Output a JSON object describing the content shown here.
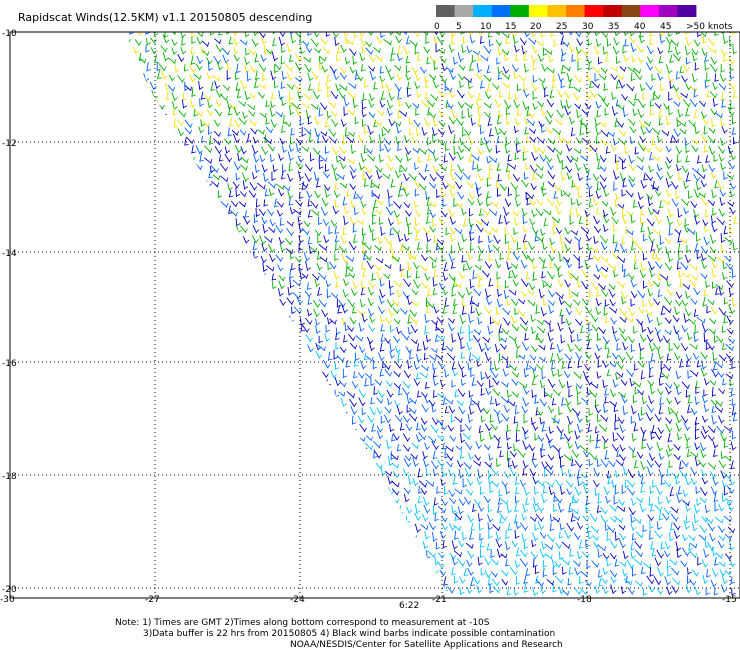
{
  "title": "Rapidscat Winds(12.5KM) v1.1 20150805 descending",
  "colorbar": {
    "labels": [
      "0",
      "5",
      "10",
      "15",
      "20",
      "25",
      "30",
      "35",
      "40",
      "45",
      ">50 knots"
    ],
    "colors": [
      "#606060",
      "#a8a8a8",
      "#00b0ff",
      "#0070ff",
      "#00b000",
      "#ffff00",
      "#ffc000",
      "#ff8000",
      "#ff0000",
      "#c00000",
      "#8b4513",
      "#ff00ff",
      "#a000c0",
      "#5000a0"
    ]
  },
  "map": {
    "lat_labels": [
      "-10",
      "-12",
      "-14",
      "-16",
      "-18",
      "-20"
    ],
    "lon_labels": [
      "-30",
      "-27",
      "-24",
      "-21",
      "-18",
      "-15"
    ],
    "time_label": "6:22",
    "time_color": "#800080",
    "swath_colors": {
      "deep": "#0000c0",
      "mid": "#0060ff",
      "light": "#00c0ff",
      "green": "#00b000",
      "yellow": "#f0e000"
    }
  },
  "notes": {
    "line1": "Note: 1) Times are GMT 2)Times along bottom correspond to measurement at -10S",
    "line2": "3)Data buffer is 22 hrs from 20150805 4) Black wind barbs indicate possible contamination",
    "line3": "NOAA/NESDIS/Center for Satellite Applications and Research"
  }
}
